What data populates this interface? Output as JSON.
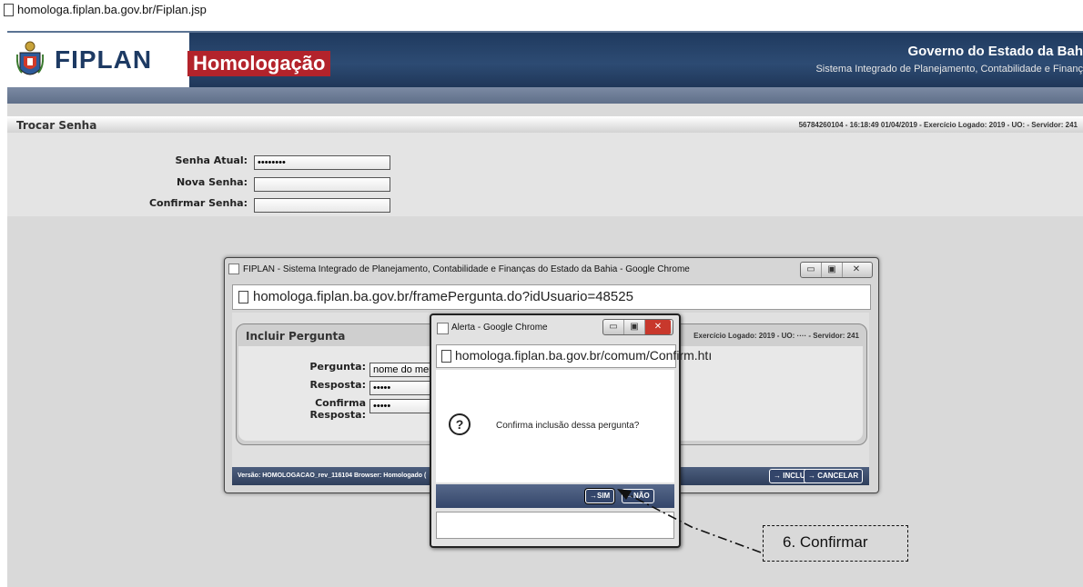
{
  "browser": {
    "url": "homologa.fiplan.ba.gov.br/Fiplan.jsp"
  },
  "header": {
    "logo_text": "FIPLAN",
    "env_badge": "Homologação",
    "gov_title": "Governo do Estado da Bah",
    "gov_subtitle": "Sistema Integrado de Planejamento, Contabilidade e Finanç",
    "colors": {
      "header_bg": "#1f3a5f",
      "badge_bg": "#b3232b"
    }
  },
  "page": {
    "title": "Trocar Senha",
    "status": "56784260104 - 16:18:49 01/04/2019 - Exercício Logado: 2019 - UO:        - Servidor: 241",
    "fields": [
      {
        "label": "Senha Atual:",
        "value": "••••••••"
      },
      {
        "label": "Nova Senha:",
        "value": ""
      },
      {
        "label": "Confirmar Senha:",
        "value": ""
      }
    ]
  },
  "popup": {
    "window_title": "FIPLAN - Sistema Integrado de Planejamento, Contabilidade e Finanças do Estado da Bahia - Google Chrome",
    "url": "homologa.fiplan.ba.gov.br/framePergunta.do?idUsuario=48525",
    "panel_title": "Incluir Pergunta",
    "status": "Exercício Logado: 2019 - UO:  ····  - Servidor: 241",
    "fields": [
      {
        "label": "Pergunta:",
        "value": "nome do meu fil"
      },
      {
        "label": "Resposta:",
        "value": "•••••"
      },
      {
        "label": "Confirma Resposta:",
        "value": "•••••"
      }
    ],
    "footer_version": "Versão: HOMOLOGACAO_rev_116104   Browser: Homologado (",
    "incluir_label": "→ INCLUIR",
    "cancelar_label": "→ CANCELAR",
    "window_buttons": [
      "▭",
      "▣",
      "✕"
    ]
  },
  "alert": {
    "window_title": "Alerta - Google Chrome",
    "url": "homologa.fiplan.ba.gov.br/comum/Confirm.htı",
    "icon": "question-icon",
    "message": "Confirma inclusão dessa pergunta?",
    "sim_label": "→SIM",
    "nao_label": "→NÃO"
  },
  "annotation": {
    "text": "6. Confirmar"
  }
}
